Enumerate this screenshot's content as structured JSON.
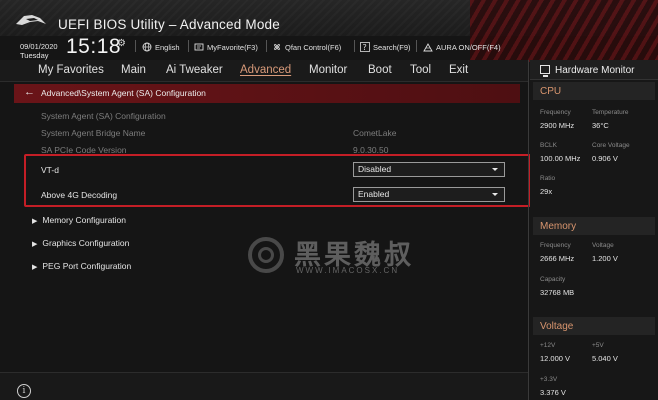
{
  "app": {
    "title": "UEFI BIOS Utility – Advanced Mode"
  },
  "infobar": {
    "date": "09/01/2020",
    "day": "Tuesday",
    "time": "15:18",
    "language": "English",
    "myfavorite": "MyFavorite(F3)",
    "qfan": "Qfan Control(F6)",
    "search": "Search(F9)",
    "aura": "AURA ON/OFF(F4)"
  },
  "menu": {
    "items": [
      "My Favorites",
      "Main",
      "Ai Tweaker",
      "Advanced",
      "Monitor",
      "Boot",
      "Tool",
      "Exit"
    ],
    "active": "Advanced"
  },
  "breadcrumb": "Advanced\\System Agent (SA) Configuration",
  "main": {
    "section_header": "System Agent (SA) Configuration",
    "info_rows": [
      {
        "label": "System Agent Bridge Name",
        "value": "CometLake"
      },
      {
        "label": "SA PCIe Code Version",
        "value": "9.0.30.50"
      }
    ],
    "options": [
      {
        "label": "VT-d",
        "value": "Disabled"
      },
      {
        "label": "Above 4G Decoding",
        "value": "Enabled"
      }
    ],
    "submenus": [
      "Memory Configuration",
      "Graphics Configuration",
      "PEG Port Configuration"
    ]
  },
  "watermark": {
    "text": "黑果魏叔",
    "url": "WWW.IMACOSX.CN"
  },
  "hardware_monitor": {
    "title": "Hardware Monitor",
    "cpu": {
      "heading": "CPU",
      "frequency_label": "Frequency",
      "frequency": "2900 MHz",
      "temperature_label": "Temperature",
      "temperature": "36°C",
      "bclk_label": "BCLK",
      "bclk": "100.00 MHz",
      "core_voltage_label": "Core Voltage",
      "core_voltage": "0.906 V",
      "ratio_label": "Ratio",
      "ratio": "29x"
    },
    "memory": {
      "heading": "Memory",
      "frequency_label": "Frequency",
      "frequency": "2666 MHz",
      "voltage_label": "Voltage",
      "voltage": "1.200 V",
      "capacity_label": "Capacity",
      "capacity": "32768 MB"
    },
    "voltage": {
      "heading": "Voltage",
      "v12_label": "+12V",
      "v12": "12.000 V",
      "v5_label": "+5V",
      "v5": "5.040 V",
      "v33_label": "+3.3V",
      "v33": "3.376 V"
    }
  }
}
